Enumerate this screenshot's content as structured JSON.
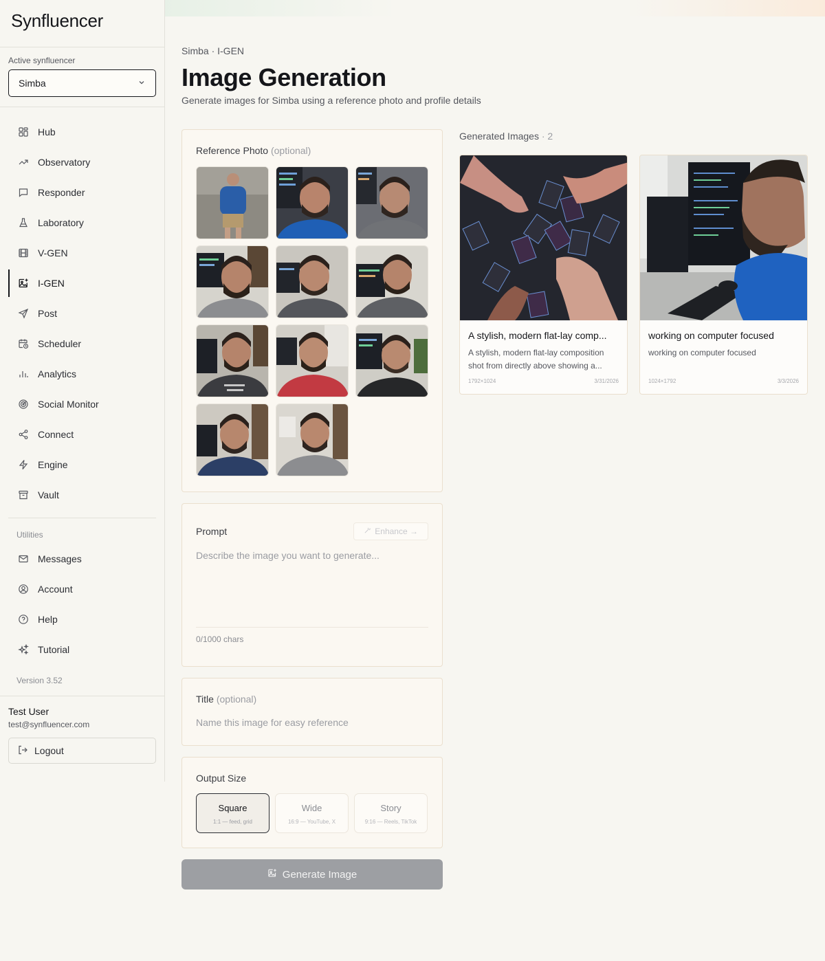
{
  "brand": {
    "name": "Synfluencer"
  },
  "sidebar": {
    "active_label": "Active synfluencer",
    "active_value": "Simba",
    "items": [
      {
        "label": "Hub",
        "icon": "grid-icon"
      },
      {
        "label": "Observatory",
        "icon": "trend-icon"
      },
      {
        "label": "Responder",
        "icon": "chat-icon"
      },
      {
        "label": "Laboratory",
        "icon": "flask-icon"
      },
      {
        "label": "V-GEN",
        "icon": "film-icon"
      },
      {
        "label": "I-GEN",
        "icon": "image-plus-icon"
      },
      {
        "label": "Post",
        "icon": "send-icon"
      },
      {
        "label": "Scheduler",
        "icon": "calendar-clock-icon"
      },
      {
        "label": "Analytics",
        "icon": "bar-chart-icon"
      },
      {
        "label": "Social Monitor",
        "icon": "radar-icon"
      },
      {
        "label": "Connect",
        "icon": "share-icon"
      },
      {
        "label": "Engine",
        "icon": "bolt-icon"
      },
      {
        "label": "Vault",
        "icon": "archive-icon"
      }
    ],
    "active_index": 5,
    "utilities_label": "Utilities",
    "utilities": [
      {
        "label": "Messages",
        "icon": "mail-icon"
      },
      {
        "label": "Account",
        "icon": "user-circle-icon"
      },
      {
        "label": "Help",
        "icon": "help-circle-icon"
      },
      {
        "label": "Tutorial",
        "icon": "sparkles-icon"
      }
    ],
    "version": "Version 3.52",
    "user": {
      "name": "Test User",
      "email": "test@synfluencer.com"
    },
    "logout_label": "Logout"
  },
  "main": {
    "breadcrumb": "Simba · I-GEN",
    "title": "Image Generation",
    "subtitle": "Generate images for Simba using a reference photo and profile details",
    "reference": {
      "label": "Reference Photo",
      "optional": "(optional)"
    },
    "prompt": {
      "label": "Prompt",
      "enhance_label": "Enhance →",
      "placeholder": "Describe the image you want to generate...",
      "chars": "0/1000 chars"
    },
    "title_field": {
      "label": "Title",
      "optional": "(optional)",
      "placeholder": "Name this image for easy reference"
    },
    "output_size": {
      "label": "Output Size",
      "options": [
        {
          "label": "Square",
          "desc": "1:1 — feed, grid"
        },
        {
          "label": "Wide",
          "desc": "16:9 — YouTube, X"
        },
        {
          "label": "Story",
          "desc": "9:16 — Reels, TikTok"
        }
      ],
      "selected": "Square"
    },
    "generate_label": "Generate Image"
  },
  "gallery": {
    "label": "Generated Images",
    "count_text": "· 2",
    "items": [
      {
        "title": "A stylish, modern flat-lay comp...",
        "desc": "A stylish, modern flat-lay composition shot from directly above showing a...",
        "size": "1792×1024",
        "date": "3/31/2026"
      },
      {
        "title": "working on computer focused",
        "desc": "working on computer focused",
        "size": "1024×1792",
        "date": "3/3/2026"
      }
    ]
  },
  "colors": {
    "accent": "#15161a",
    "card_border": "#eadfce",
    "button_disabled": "#9d9fa3"
  }
}
